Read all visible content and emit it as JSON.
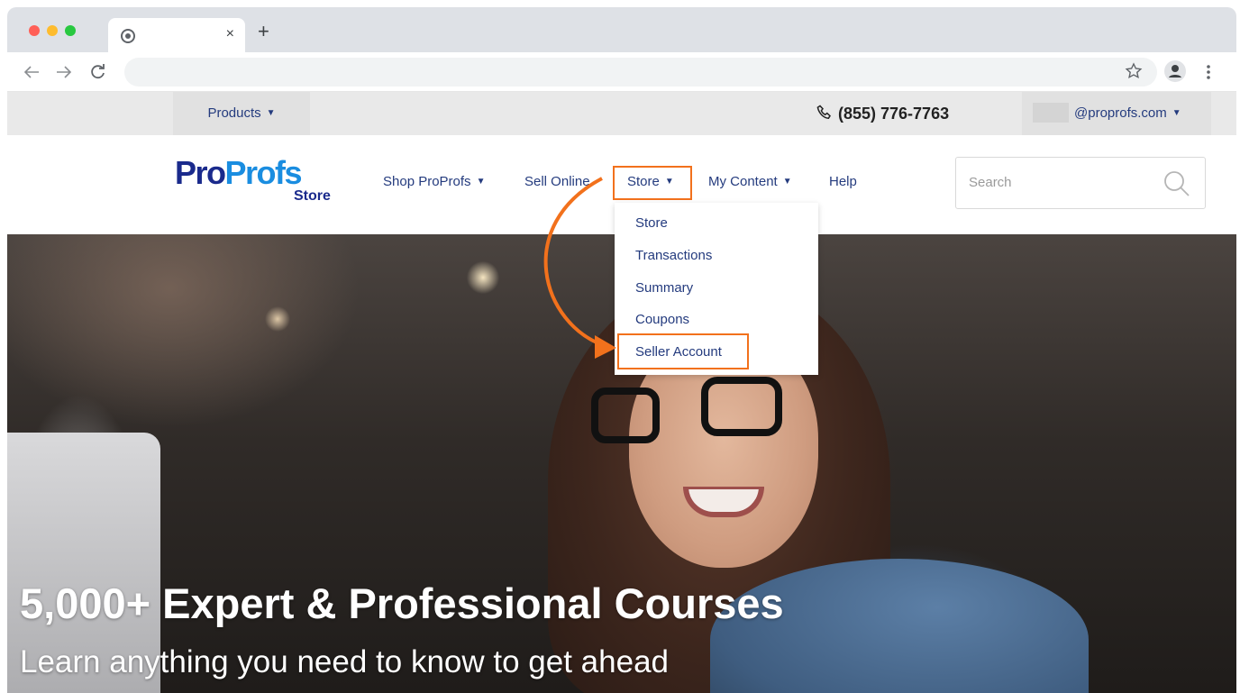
{
  "browser": {
    "new_tab_symbol": "+",
    "tab_close_symbol": "×",
    "icons": [
      "chrome-favicon-icon",
      "back-arrow-icon",
      "forward-arrow-icon",
      "reload-icon",
      "star-icon",
      "profile-icon",
      "kebab-menu-icon"
    ]
  },
  "topbar": {
    "products_label": "Products",
    "phone": "(855) 776-7763",
    "account_email": "@proprofs.com"
  },
  "logo": {
    "part1": "Pro",
    "part2": "Profs",
    "sub": "Store"
  },
  "nav": {
    "shop": "Shop ProProfs",
    "sell": "Sell Online",
    "store": "Store",
    "my_content": "My Content",
    "help": "Help"
  },
  "search": {
    "placeholder": "Search"
  },
  "dropdown": {
    "items": [
      "Store",
      "Transactions",
      "Summary",
      "Coupons",
      "Seller Account"
    ]
  },
  "hero": {
    "title": "5,000+ Expert & Professional Courses",
    "subtitle": "Learn anything you need to know to get ahead"
  },
  "colors": {
    "accent_orange": "#f2711c",
    "link_navy": "#243b7e",
    "logo_navy": "#1a2a8c",
    "logo_blue": "#1a8de0"
  }
}
